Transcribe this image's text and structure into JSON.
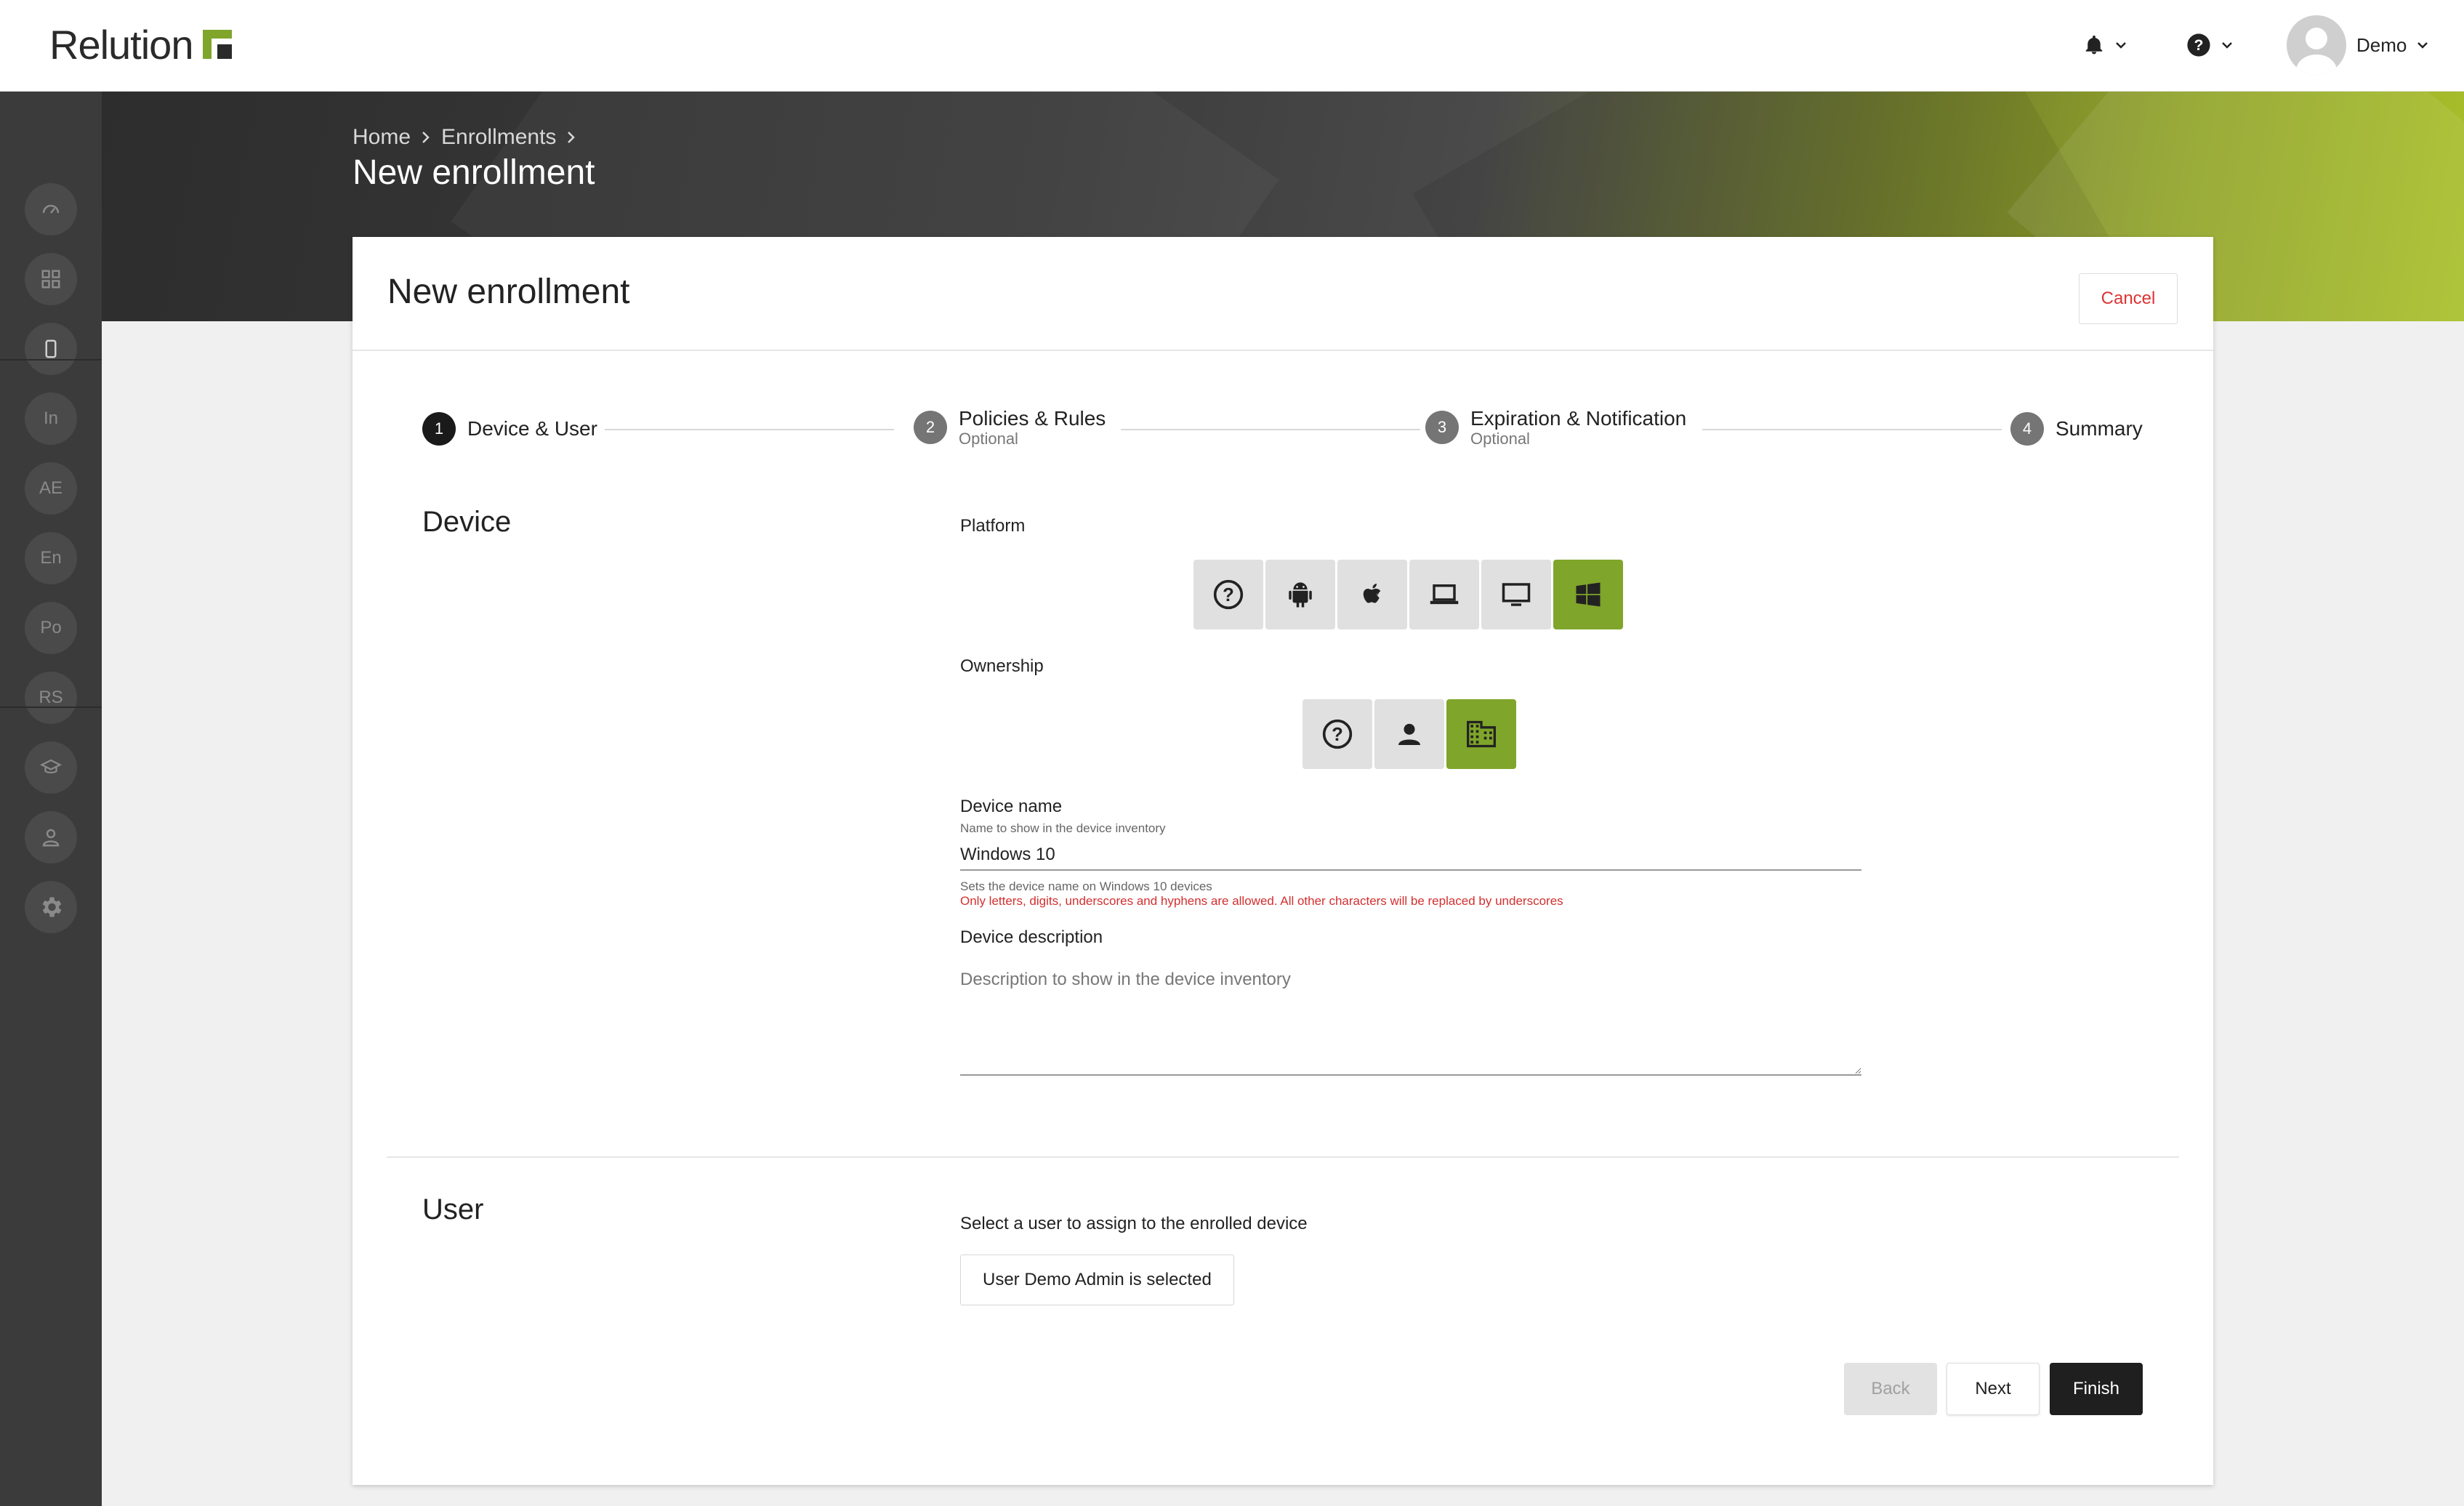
{
  "app": {
    "name": "Relution"
  },
  "topbar": {
    "user_name": "Demo"
  },
  "sidebar": {
    "items": [
      {
        "icon": "dashboard-icon"
      },
      {
        "icon": "apps-grid-icon"
      },
      {
        "icon": "device-icon"
      },
      {
        "label": "In"
      },
      {
        "label": "AE"
      },
      {
        "label": "En"
      },
      {
        "label": "Po"
      },
      {
        "label": "RS"
      },
      {
        "icon": "education-icon"
      },
      {
        "icon": "user-icon"
      },
      {
        "icon": "gear-icon"
      }
    ]
  },
  "header": {
    "breadcrumb": [
      "Home",
      "Enrollments"
    ],
    "title": "New enrollment"
  },
  "card": {
    "title": "New enrollment",
    "cancel_label": "Cancel"
  },
  "stepper": {
    "steps": [
      {
        "num": "1",
        "label": "Device & User",
        "sub": ""
      },
      {
        "num": "2",
        "label": "Policies & Rules",
        "sub": "Optional"
      },
      {
        "num": "3",
        "label": "Expiration & Notification",
        "sub": "Optional"
      },
      {
        "num": "4",
        "label": "Summary",
        "sub": ""
      }
    ],
    "active_step": 1
  },
  "device": {
    "section_title": "Device",
    "platform_label": "Platform",
    "platform_options": [
      "unknown",
      "android",
      "apple",
      "macos",
      "windows-desktop",
      "windows"
    ],
    "platform_selected": "windows",
    "ownership_label": "Ownership",
    "ownership_options": [
      "unknown",
      "personal",
      "company"
    ],
    "ownership_selected": "company",
    "name_label": "Device name",
    "name_hint": "Name to show in the device inventory",
    "name_value": "Windows 10",
    "name_help": "Sets the device name on Windows 10 devices",
    "name_error": "Only letters, digits, underscores and hyphens are allowed. All other characters will be replaced by underscores",
    "description_label": "Device description",
    "description_placeholder": "Description to show in the device inventory"
  },
  "user": {
    "section_title": "User",
    "prompt": "Select a user to assign to the enrolled device",
    "selected_button": "User Demo Admin is selected"
  },
  "footer": {
    "back_label": "Back",
    "next_label": "Next",
    "finish_label": "Finish"
  },
  "colors": {
    "accent": "#7fa52a",
    "dark": "#1f1f1f",
    "error": "#d32f2f"
  }
}
